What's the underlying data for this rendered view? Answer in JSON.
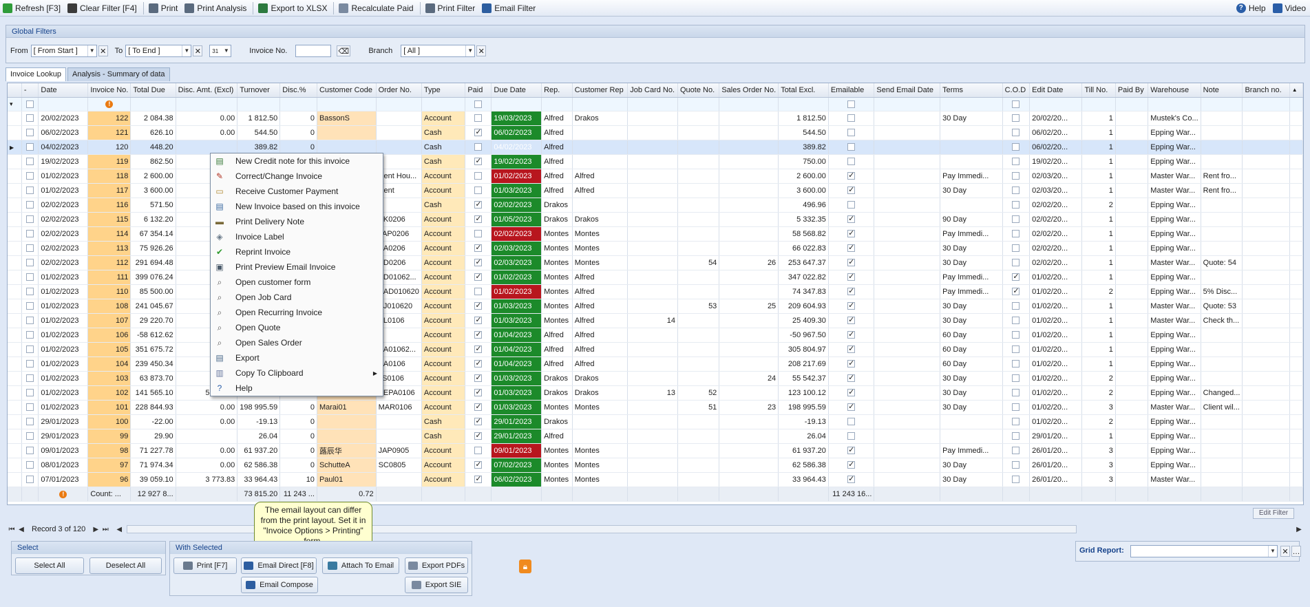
{
  "toolbar": {
    "left": [
      {
        "label": "Refresh [F3]",
        "icon": "refresh-icon",
        "color": "#2f9c3a"
      },
      {
        "label": "Clear Filter [F4]",
        "icon": "clear-filter-icon",
        "color": "#3b3b3b"
      },
      {
        "label": "Print",
        "icon": "printer-icon",
        "color": "#5a6a7e"
      },
      {
        "label": "Print Analysis",
        "icon": "print-analysis-icon",
        "color": "#5a6a7e"
      },
      {
        "label": "Export to XLSX",
        "icon": "export-xlsx-icon",
        "color": "#2c7a3f"
      },
      {
        "label": "Recalculate Paid",
        "icon": "recalculate-icon",
        "color": "#7a8aa0"
      },
      {
        "label": "Print Filter",
        "icon": "print-filter-icon",
        "color": "#5a6a7e"
      },
      {
        "label": "Email Filter",
        "icon": "email-filter-icon",
        "color": "#2d5ea0"
      }
    ],
    "help": "Help",
    "video": "Video"
  },
  "global_filters": {
    "title": "Global Filters",
    "from_label": "From",
    "from_value": "[ From Start ]",
    "to_label": "To",
    "to_value": "[ To End ]",
    "calendar_value": "31",
    "invoice_label": "Invoice No.",
    "invoice_value": "",
    "branch_label": "Branch",
    "branch_value": "[ All ]"
  },
  "tabs": [
    "Invoice Lookup",
    "Analysis - Summary of data"
  ],
  "columns": [
    "-",
    "Date",
    "Invoice No.",
    "Total Due",
    "Disc. Amt. (Excl)",
    "Turnover",
    "Disc.%",
    "Customer Code",
    "Order No.",
    "Type",
    "Paid",
    "Due Date",
    "Rep.",
    "Customer Rep",
    "Job Card No.",
    "Quote No.",
    "Sales Order No.",
    "Total Excl.",
    "Emailable",
    "Send Email Date",
    "Terms",
    "C.O.D",
    "Edit Date",
    "Till No.",
    "Paid By",
    "Warehouse",
    "Note",
    "Branch no."
  ],
  "rows": [
    {
      "date": "20/02/2023",
      "inv": "122",
      "total": "2 084.38",
      "disc": "0.00",
      "turn": "1 812.50",
      "discp": "0",
      "cust": "BassonS",
      "order": "",
      "type": "Account",
      "paid": false,
      "due": "19/03/2023",
      "dueColor": "g",
      "rep": "Alfred",
      "crep": "Drakos",
      "job": "",
      "quote": "",
      "so": "",
      "excl": "1 812.50",
      "email": false,
      "terms": "30 Day",
      "cod": false,
      "edit": "20/02/20...",
      "till": "1",
      "wh": "Mustek's Co...",
      "note": ""
    },
    {
      "date": "06/02/2023",
      "inv": "121",
      "total": "626.10",
      "disc": "0.00",
      "turn": "544.50",
      "discp": "0",
      "cust": "",
      "order": "",
      "type": "Cash",
      "paid": true,
      "due": "06/02/2023",
      "dueColor": "g",
      "rep": "Alfred",
      "crep": "",
      "job": "",
      "quote": "",
      "so": "",
      "excl": "544.50",
      "email": false,
      "terms": "",
      "cod": false,
      "edit": "06/02/20...",
      "till": "1",
      "wh": "Epping War...",
      "note": ""
    },
    {
      "date": "04/02/2023",
      "inv": "120",
      "total": "448.20",
      "disc": "",
      "turn": "389.82",
      "discp": "0",
      "cust": "",
      "order": "",
      "type": "Cash",
      "paid": false,
      "due": "04/02/2023",
      "dueColor": "r",
      "rep": "Alfred",
      "crep": "",
      "job": "",
      "quote": "",
      "so": "",
      "excl": "389.82",
      "email": false,
      "terms": "",
      "cod": false,
      "edit": "06/02/20...",
      "till": "1",
      "wh": "Epping War...",
      "note": ""
    },
    {
      "date": "19/02/2023",
      "inv": "119",
      "total": "862.50",
      "disc": "",
      "turn": "",
      "discp": "",
      "cust": "",
      "order": "",
      "type": "Cash",
      "paid": true,
      "due": "19/02/2023",
      "dueColor": "g",
      "rep": "Alfred",
      "crep": "",
      "job": "",
      "quote": "",
      "so": "",
      "excl": "750.00",
      "email": false,
      "terms": "",
      "cod": false,
      "edit": "19/02/20...",
      "till": "1",
      "wh": "Epping War...",
      "note": ""
    },
    {
      "date": "01/02/2023",
      "inv": "118",
      "total": "2 600.00",
      "disc": "",
      "turn": "",
      "discp": "",
      "cust": "",
      "order": "Rent Hou...",
      "type": "Account",
      "paid": false,
      "due": "01/02/2023",
      "dueColor": "r",
      "rep": "Alfred",
      "crep": "Alfred",
      "job": "",
      "quote": "",
      "so": "",
      "excl": "2 600.00",
      "email": true,
      "terms": "Pay Immedi...",
      "cod": false,
      "edit": "02/03/20...",
      "till": "1",
      "wh": "Master War...",
      "note": "Rent fro..."
    },
    {
      "date": "01/02/2023",
      "inv": "117",
      "total": "3 600.00",
      "disc": "",
      "turn": "",
      "discp": "",
      "cust": "",
      "order": "Rent",
      "type": "Account",
      "paid": false,
      "due": "01/03/2023",
      "dueColor": "g",
      "rep": "Alfred",
      "crep": "Alfred",
      "job": "",
      "quote": "",
      "so": "",
      "excl": "3 600.00",
      "email": true,
      "terms": "30 Day",
      "cod": false,
      "edit": "02/03/20...",
      "till": "1",
      "wh": "Master War...",
      "note": "Rent fro..."
    },
    {
      "date": "02/02/2023",
      "inv": "116",
      "total": "571.50",
      "disc": "",
      "turn": "",
      "discp": "",
      "cust": "",
      "order": "",
      "type": "Cash",
      "paid": true,
      "due": "02/02/2023",
      "dueColor": "g",
      "rep": "Drakos",
      "crep": "",
      "job": "",
      "quote": "",
      "so": "",
      "excl": "496.96",
      "email": false,
      "terms": "",
      "cod": false,
      "edit": "02/02/20...",
      "till": "2",
      "wh": "Epping War...",
      "note": ""
    },
    {
      "date": "02/02/2023",
      "inv": "115",
      "total": "6 132.20",
      "disc": "",
      "turn": "",
      "discp": "",
      "cust": "",
      "order": "BK0206",
      "type": "Account",
      "paid": true,
      "due": "01/05/2023",
      "dueColor": "g",
      "rep": "Drakos",
      "crep": "Drakos",
      "job": "",
      "quote": "",
      "so": "",
      "excl": "5 332.35",
      "email": true,
      "terms": "90 Day",
      "cod": false,
      "edit": "02/02/20...",
      "till": "1",
      "wh": "Epping War...",
      "note": ""
    },
    {
      "date": "02/02/2023",
      "inv": "114",
      "total": "67 354.14",
      "disc": "",
      "turn": "",
      "discp": "",
      "cust": "",
      "order": "JAP0206",
      "type": "Account",
      "paid": false,
      "due": "02/02/2023",
      "dueColor": "r",
      "rep": "Montes",
      "crep": "Montes",
      "job": "",
      "quote": "",
      "so": "",
      "excl": "58 568.82",
      "email": true,
      "terms": "Pay Immedi...",
      "cod": false,
      "edit": "02/02/20...",
      "till": "1",
      "wh": "Epping War...",
      "note": ""
    },
    {
      "date": "02/02/2023",
      "inv": "113",
      "total": "75 926.26",
      "disc": "",
      "turn": "",
      "discp": "",
      "cust": "",
      "order": "SA0206",
      "type": "Account",
      "paid": true,
      "due": "02/03/2023",
      "dueColor": "g",
      "rep": "Montes",
      "crep": "Montes",
      "job": "",
      "quote": "",
      "so": "",
      "excl": "66 022.83",
      "email": true,
      "terms": "30 Day",
      "cod": false,
      "edit": "02/02/20...",
      "till": "1",
      "wh": "Epping War...",
      "note": ""
    },
    {
      "date": "02/02/2023",
      "inv": "112",
      "total": "291 694.48",
      "disc": "",
      "turn": "",
      "discp": "",
      "cust": "",
      "order": "PD0206",
      "type": "Account",
      "paid": true,
      "due": "02/03/2023",
      "dueColor": "g",
      "rep": "Montes",
      "crep": "Montes",
      "job": "",
      "quote": "54",
      "so": "26",
      "excl": "253 647.37",
      "email": true,
      "terms": "30 Day",
      "cod": false,
      "edit": "02/02/20...",
      "till": "1",
      "wh": "Master War...",
      "note": "Quote: 54"
    },
    {
      "date": "01/02/2023",
      "inv": "111",
      "total": "399 076.24",
      "disc": "",
      "turn": "",
      "discp": "",
      "cust": "",
      "order": "BD01062...",
      "type": "Account",
      "paid": true,
      "due": "01/02/2023",
      "dueColor": "g",
      "rep": "Montes",
      "crep": "Alfred",
      "job": "",
      "quote": "",
      "so": "",
      "excl": "347 022.82",
      "email": true,
      "terms": "Pay Immedi...",
      "cod": true,
      "edit": "01/02/20...",
      "till": "1",
      "wh": "Epping War...",
      "note": ""
    },
    {
      "date": "01/02/2023",
      "inv": "110",
      "total": "85 500.00",
      "disc": "",
      "turn": "",
      "discp": "",
      "cust": "",
      "order": "BAD010620",
      "type": "Account",
      "paid": false,
      "due": "01/02/2023",
      "dueColor": "r",
      "rep": "Montes",
      "crep": "Alfred",
      "job": "",
      "quote": "",
      "so": "",
      "excl": "74 347.83",
      "email": true,
      "terms": "Pay Immedi...",
      "cod": true,
      "edit": "01/02/20...",
      "till": "2",
      "wh": "Epping War...",
      "note": "5% Disc..."
    },
    {
      "date": "01/02/2023",
      "inv": "108",
      "total": "241 045.67",
      "disc": "",
      "turn": "",
      "discp": "",
      "cust": "",
      "order": "BJ010620",
      "type": "Account",
      "paid": true,
      "due": "01/03/2023",
      "dueColor": "g",
      "rep": "Montes",
      "crep": "Alfred",
      "job": "",
      "quote": "53",
      "so": "25",
      "excl": "209 604.93",
      "email": true,
      "terms": "30 Day",
      "cod": false,
      "edit": "01/02/20...",
      "till": "1",
      "wh": "Master War...",
      "note": "Quote: 53"
    },
    {
      "date": "01/02/2023",
      "inv": "107",
      "total": "29 220.70",
      "disc": "",
      "turn": "",
      "discp": "",
      "cust": "",
      "order": "AL0106",
      "type": "Account",
      "paid": true,
      "due": "01/03/2023",
      "dueColor": "g",
      "rep": "Montes",
      "crep": "Alfred",
      "job": "14",
      "quote": "",
      "so": "",
      "excl": "25 409.30",
      "email": true,
      "terms": "30 Day",
      "cod": false,
      "edit": "01/02/20...",
      "till": "1",
      "wh": "Master War...",
      "note": "Check th..."
    },
    {
      "date": "01/02/2023",
      "inv": "106",
      "total": "-58 612.62",
      "disc": "",
      "turn": "",
      "discp": "",
      "cust": "",
      "order": "",
      "type": "Account",
      "paid": true,
      "due": "01/04/2023",
      "dueColor": "g",
      "rep": "Alfred",
      "crep": "Alfred",
      "job": "",
      "quote": "",
      "so": "",
      "excl": "-50 967.50",
      "email": true,
      "terms": "60 Day",
      "cod": false,
      "edit": "01/02/20...",
      "till": "1",
      "wh": "Epping War...",
      "note": ""
    },
    {
      "date": "01/02/2023",
      "inv": "105",
      "total": "351 675.72",
      "disc": "",
      "turn": "",
      "discp": "",
      "cust": "",
      "order": "BA01062...",
      "type": "Account",
      "paid": true,
      "due": "01/04/2023",
      "dueColor": "g",
      "rep": "Alfred",
      "crep": "Alfred",
      "job": "",
      "quote": "",
      "so": "",
      "excl": "305 804.97",
      "email": true,
      "terms": "60 Day",
      "cod": false,
      "edit": "01/02/20...",
      "till": "1",
      "wh": "Epping War...",
      "note": ""
    },
    {
      "date": "01/02/2023",
      "inv": "104",
      "total": "239 450.34",
      "disc": "",
      "turn": "",
      "discp": "",
      "cust": "",
      "order": "BA0106",
      "type": "Account",
      "paid": true,
      "due": "01/04/2023",
      "dueColor": "g",
      "rep": "Alfred",
      "crep": "Alfred",
      "job": "",
      "quote": "",
      "so": "",
      "excl": "208 217.69",
      "email": true,
      "terms": "60 Day",
      "cod": false,
      "edit": "01/02/20...",
      "till": "1",
      "wh": "Epping War...",
      "note": ""
    },
    {
      "date": "01/02/2023",
      "inv": "103",
      "total": "63 873.70",
      "disc": "",
      "turn": "",
      "discp": "",
      "cust": "",
      "order": "JS0106",
      "type": "Account",
      "paid": true,
      "due": "01/03/2023",
      "dueColor": "g",
      "rep": "Drakos",
      "crep": "Drakos",
      "job": "",
      "quote": "",
      "so": "24",
      "excl": "55 542.37",
      "email": true,
      "terms": "30 Day",
      "cod": false,
      "edit": "01/02/20...",
      "till": "2",
      "wh": "Epping War...",
      "note": ""
    },
    {
      "date": "01/02/2023",
      "inv": "102",
      "total": "141 565.10",
      "disc": "5 216.19",
      "turn": "123 100.12",
      "discp": "4.07",
      "cust": "BEPA",
      "order": "BEPA0106",
      "type": "Account",
      "paid": true,
      "due": "01/03/2023",
      "dueColor": "g",
      "rep": "Drakos",
      "crep": "Drakos",
      "job": "13",
      "quote": "52",
      "so": "",
      "excl": "123 100.12",
      "email": true,
      "terms": "30 Day",
      "cod": false,
      "edit": "01/02/20...",
      "till": "2",
      "wh": "Epping War...",
      "note": "Changed..."
    },
    {
      "date": "01/02/2023",
      "inv": "101",
      "total": "228 844.93",
      "disc": "0.00",
      "turn": "198 995.59",
      "discp": "0",
      "cust": "Marai01",
      "order": "MAR0106",
      "type": "Account",
      "paid": true,
      "due": "01/03/2023",
      "dueColor": "g",
      "rep": "Montes",
      "crep": "Montes",
      "job": "",
      "quote": "51",
      "so": "23",
      "excl": "198 995.59",
      "email": true,
      "terms": "30 Day",
      "cod": false,
      "edit": "01/02/20...",
      "till": "3",
      "wh": "Master War...",
      "note": "Client wil..."
    },
    {
      "date": "29/01/2023",
      "inv": "100",
      "total": "-22.00",
      "disc": "0.00",
      "turn": "-19.13",
      "discp": "0",
      "cust": "",
      "order": "",
      "type": "Cash",
      "paid": true,
      "due": "29/01/2023",
      "dueColor": "g",
      "rep": "Drakos",
      "crep": "",
      "job": "",
      "quote": "",
      "so": "",
      "excl": "-19.13",
      "email": false,
      "terms": "",
      "cod": false,
      "edit": "01/02/20...",
      "till": "2",
      "wh": "Epping War...",
      "note": ""
    },
    {
      "date": "29/01/2023",
      "inv": "99",
      "total": "29.90",
      "disc": "",
      "turn": "26.04",
      "discp": "0",
      "cust": "",
      "order": "",
      "type": "Cash",
      "paid": true,
      "due": "29/01/2023",
      "dueColor": "g",
      "rep": "Alfred",
      "crep": "",
      "job": "",
      "quote": "",
      "so": "",
      "excl": "26.04",
      "email": false,
      "terms": "",
      "cod": false,
      "edit": "29/01/20...",
      "till": "1",
      "wh": "Epping War...",
      "note": ""
    },
    {
      "date": "09/01/2023",
      "inv": "98",
      "total": "71 227.78",
      "disc": "0.00",
      "turn": "61 937.20",
      "discp": "0",
      "cust": "蕗辰华",
      "order": "JAP0905",
      "type": "Account",
      "paid": false,
      "due": "09/01/2023",
      "dueColor": "r",
      "rep": "Montes",
      "crep": "Montes",
      "job": "",
      "quote": "",
      "so": "",
      "excl": "61 937.20",
      "email": true,
      "terms": "Pay Immedi...",
      "cod": false,
      "edit": "26/01/20...",
      "till": "3",
      "wh": "Epping War...",
      "note": ""
    },
    {
      "date": "08/01/2023",
      "inv": "97",
      "total": "71 974.34",
      "disc": "0.00",
      "turn": "62 586.38",
      "discp": "0",
      "cust": "SchutteA",
      "order": "SC0805",
      "type": "Account",
      "paid": true,
      "due": "07/02/2023",
      "dueColor": "g",
      "rep": "Montes",
      "crep": "Montes",
      "job": "",
      "quote": "",
      "so": "",
      "excl": "62 586.38",
      "email": true,
      "terms": "30 Day",
      "cod": false,
      "edit": "26/01/20...",
      "till": "3",
      "wh": "Epping War...",
      "note": ""
    },
    {
      "date": "07/01/2023",
      "inv": "96",
      "total": "39 059.10",
      "disc": "3 773.83",
      "turn": "33 964.43",
      "discp": "10",
      "cust": "Paul01",
      "order": "",
      "type": "Account",
      "paid": true,
      "due": "06/02/2023",
      "dueColor": "g",
      "rep": "Montes",
      "crep": "Montes",
      "job": "",
      "quote": "",
      "so": "",
      "excl": "33 964.43",
      "email": true,
      "terms": "30 Day",
      "cod": false,
      "edit": "26/01/20...",
      "till": "3",
      "wh": "Master War...",
      "note": ""
    }
  ],
  "summary": {
    "count": "Count: ...",
    "total": "12 927 8...",
    "disc": "73 815.20",
    "turn": "11 243 ...",
    "discp": "0.72",
    "excl": "11 243 16..."
  },
  "context_menu": [
    {
      "label": "New Credit note for this invoice",
      "icon": "credit-note-icon",
      "glyph": "▤",
      "color": "#3a7a3a"
    },
    {
      "label": "Correct/Change Invoice",
      "icon": "correct-invoice-icon",
      "glyph": "✎",
      "color": "#b03020"
    },
    {
      "label": "Receive Customer Payment",
      "icon": "payment-icon",
      "glyph": "▭",
      "color": "#b08a30"
    },
    {
      "label": "New Invoice based on this invoice",
      "icon": "new-invoice-icon",
      "glyph": "▤",
      "color": "#3a6aa0"
    },
    {
      "label": "Print Delivery Note",
      "icon": "truck-icon",
      "glyph": "▬",
      "color": "#7a6a3a"
    },
    {
      "label": "Invoice Label",
      "icon": "label-icon",
      "glyph": "◈",
      "color": "#6a7a8a"
    },
    {
      "label": "Reprint Invoice",
      "icon": "check-icon",
      "glyph": "✔",
      "color": "#2e9a2e"
    },
    {
      "label": "Print Preview Email Invoice",
      "icon": "preview-icon",
      "glyph": "▣",
      "color": "#4a5a6a"
    },
    {
      "label": "Open customer form",
      "icon": "search-icon",
      "glyph": "⌕",
      "color": "#555"
    },
    {
      "label": "Open Job Card",
      "icon": "search-icon",
      "glyph": "⌕",
      "color": "#555"
    },
    {
      "label": "Open Recurring Invoice",
      "icon": "search-icon",
      "glyph": "⌕",
      "color": "#555"
    },
    {
      "label": "Open Quote",
      "icon": "search-icon",
      "glyph": "⌕",
      "color": "#555"
    },
    {
      "label": "Open Sales Order",
      "icon": "search-icon",
      "glyph": "⌕",
      "color": "#555"
    },
    {
      "label": "Export",
      "icon": "export-icon",
      "glyph": "▤",
      "color": "#4a6a8a"
    },
    {
      "label": "Copy To Clipboard",
      "icon": "clipboard-icon",
      "glyph": "▥",
      "color": "#6a7aa0",
      "submenu": true
    },
    {
      "label": "Help",
      "icon": "help-icon",
      "glyph": "?",
      "color": "#2a5ea8"
    }
  ],
  "nav": {
    "record": "Record 3 of 120",
    "edit_filter": "Edit Filter"
  },
  "tooltip": "The email layout can differ from the print layout. Set it in \"Invoice Options > Printing\" form.",
  "select_box": {
    "title": "Select",
    "select_all": "Select All",
    "deselect_all": "Deselect All"
  },
  "with_selected": {
    "title": "With Selected",
    "print": "Print [F7]",
    "email_direct": "Email Direct [F8]",
    "attach": "Attach To Email",
    "export_pdfs": "Export PDFs",
    "email_compose": "Email Compose",
    "export_sie": "Export SIE"
  },
  "grid_report": {
    "label": "Grid Report:",
    "value": ""
  }
}
